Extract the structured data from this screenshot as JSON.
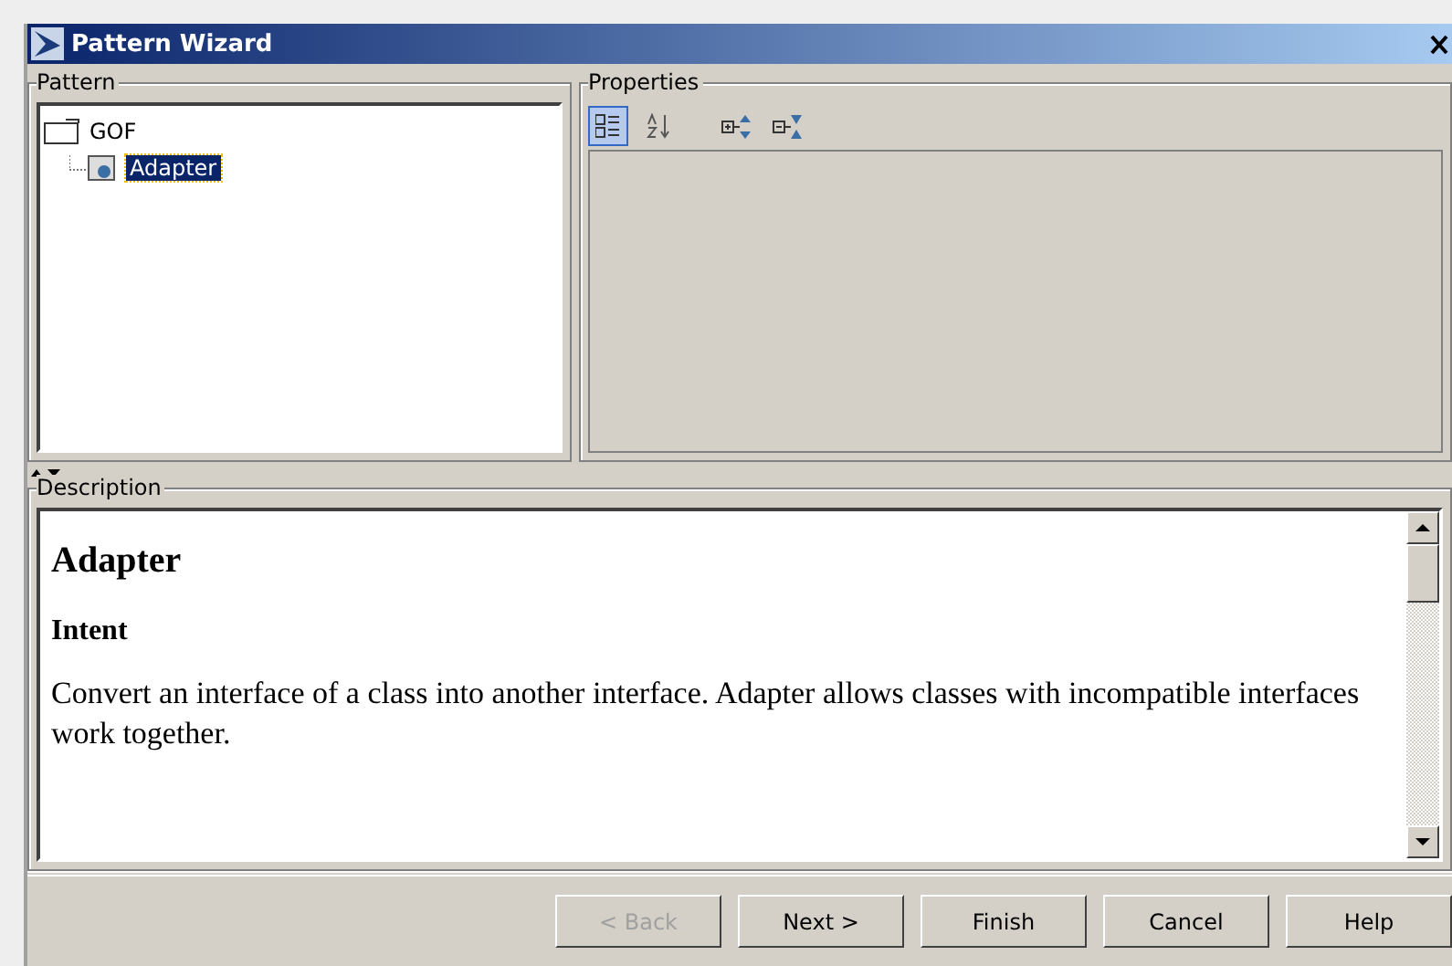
{
  "window": {
    "title": "Pattern Wizard"
  },
  "pattern": {
    "legend": "Pattern",
    "tree": [
      {
        "label": "GOF",
        "selected": false,
        "children": [
          {
            "label": "Adapter",
            "selected": true
          }
        ]
      }
    ]
  },
  "properties": {
    "legend": "Properties",
    "tools": [
      {
        "kind": "categorized",
        "selected": true
      },
      {
        "kind": "alphabetical",
        "selected": false
      },
      {
        "kind": "expand",
        "selected": false
      },
      {
        "kind": "collapse",
        "selected": false
      }
    ]
  },
  "description": {
    "legend": "Description",
    "heading": "Adapter",
    "subheading": "Intent",
    "paragraph": "Convert an interface of a class into another interface. Adapter allows classes with incompatible interfaces work together."
  },
  "buttons": [
    {
      "label": "< Back",
      "disabled": true
    },
    {
      "label": "Next >",
      "disabled": false
    },
    {
      "label": "Finish",
      "disabled": false
    },
    {
      "label": "Cancel",
      "disabled": false
    },
    {
      "label": "Help",
      "disabled": false
    }
  ]
}
